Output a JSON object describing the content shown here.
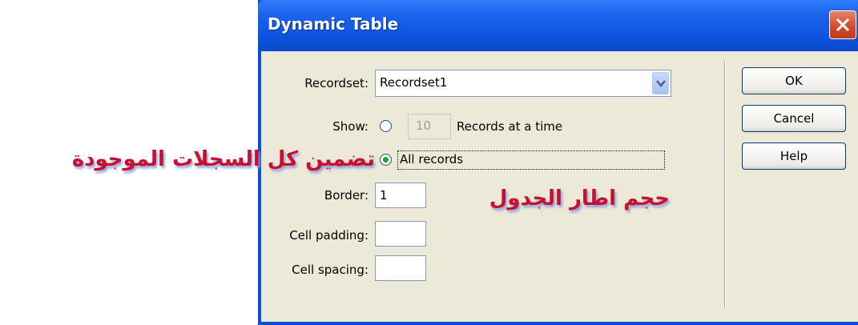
{
  "dialog": {
    "title": "Dynamic Table",
    "recordset": {
      "label": "Recordset:",
      "value": "Recordset1"
    },
    "show": {
      "label": "Show:",
      "records_count": "10",
      "records_at_time_label": "Records at a time",
      "all_records_label": "All records",
      "selected": "all_records"
    },
    "border": {
      "label": "Border:",
      "value": "1"
    },
    "cell_padding": {
      "label": "Cell padding:",
      "value": ""
    },
    "cell_spacing": {
      "label": "Cell spacing:",
      "value": ""
    },
    "buttons": {
      "ok": "OK",
      "cancel": "Cancel",
      "help": "Help"
    }
  },
  "annotations": {
    "all_records_note": "تضمين كل السجلات الموجودة",
    "border_note": "حجم اطار الجدول"
  },
  "colors": {
    "titlebar": "#0a54e0",
    "client": "#ece9d8",
    "annotation": "#c8102e"
  }
}
